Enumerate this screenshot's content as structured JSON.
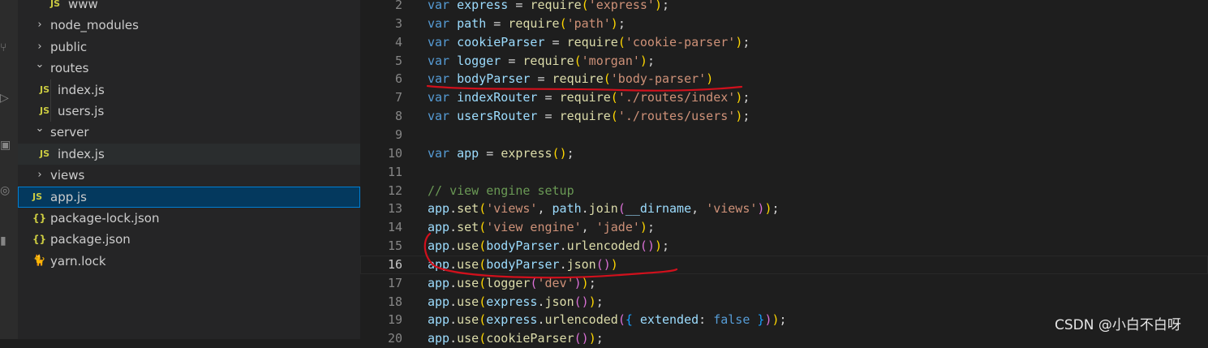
{
  "explorer": {
    "items": [
      {
        "name": "www",
        "icon": "js-file-icon",
        "icon_text": "JS"
      },
      {
        "name": "node_modules",
        "icon": "chevron-right-icon",
        "expanded": false
      },
      {
        "name": "public",
        "icon": "chevron-right-icon",
        "expanded": false
      },
      {
        "name": "routes",
        "icon": "chevron-down-icon",
        "expanded": true
      },
      {
        "name": "index.js",
        "icon": "js-file-icon",
        "icon_text": "JS"
      },
      {
        "name": "users.js",
        "icon": "js-file-icon",
        "icon_text": "JS"
      },
      {
        "name": "server",
        "icon": "chevron-down-icon",
        "expanded": true
      },
      {
        "name": "index.js",
        "icon": "js-file-icon",
        "icon_text": "JS"
      },
      {
        "name": "views",
        "icon": "chevron-right-icon",
        "expanded": false
      },
      {
        "name": "app.js",
        "icon": "js-file-icon",
        "icon_text": "JS",
        "selected": true
      },
      {
        "name": "package-lock.json",
        "icon": "json-file-icon",
        "icon_text": "{}"
      },
      {
        "name": "package.json",
        "icon": "json-file-icon",
        "icon_text": "{}"
      },
      {
        "name": "yarn.lock",
        "icon": "yarn-icon",
        "icon_text": "🐈"
      }
    ]
  },
  "editor": {
    "active_line": 16,
    "lines": [
      {
        "n": "2",
        "tokens": [
          [
            "kw",
            "var"
          ],
          [
            "p",
            " "
          ],
          [
            "vr",
            "express"
          ],
          [
            "p",
            " = "
          ],
          [
            "fn",
            "require"
          ],
          [
            "b1",
            "("
          ],
          [
            "st",
            "'express'"
          ],
          [
            "b1",
            ")"
          ],
          [
            "p",
            ";"
          ]
        ]
      },
      {
        "n": "3",
        "tokens": [
          [
            "kw",
            "var"
          ],
          [
            "p",
            " "
          ],
          [
            "vr",
            "path"
          ],
          [
            "p",
            " = "
          ],
          [
            "fn",
            "require"
          ],
          [
            "b1",
            "("
          ],
          [
            "st",
            "'path'"
          ],
          [
            "b1",
            ")"
          ],
          [
            "p",
            ";"
          ]
        ]
      },
      {
        "n": "4",
        "tokens": [
          [
            "kw",
            "var"
          ],
          [
            "p",
            " "
          ],
          [
            "vr",
            "cookieParser"
          ],
          [
            "p",
            " = "
          ],
          [
            "fn",
            "require"
          ],
          [
            "b1",
            "("
          ],
          [
            "st",
            "'cookie-parser'"
          ],
          [
            "b1",
            ")"
          ],
          [
            "p",
            ";"
          ]
        ]
      },
      {
        "n": "5",
        "tokens": [
          [
            "kw",
            "var"
          ],
          [
            "p",
            " "
          ],
          [
            "vr",
            "logger"
          ],
          [
            "p",
            " = "
          ],
          [
            "fn",
            "require"
          ],
          [
            "b1",
            "("
          ],
          [
            "st",
            "'morgan'"
          ],
          [
            "b1",
            ")"
          ],
          [
            "p",
            ";"
          ]
        ]
      },
      {
        "n": "6",
        "tokens": [
          [
            "kw",
            "var"
          ],
          [
            "p",
            " "
          ],
          [
            "vr",
            "bodyParser"
          ],
          [
            "p",
            " = "
          ],
          [
            "fn",
            "require"
          ],
          [
            "b1",
            "("
          ],
          [
            "st",
            "'body-parser'"
          ],
          [
            "b1",
            ")"
          ]
        ]
      },
      {
        "n": "7",
        "tokens": [
          [
            "kw",
            "var"
          ],
          [
            "p",
            " "
          ],
          [
            "vr",
            "indexRouter"
          ],
          [
            "p",
            " = "
          ],
          [
            "fn",
            "require"
          ],
          [
            "b1",
            "("
          ],
          [
            "st",
            "'./routes/index'"
          ],
          [
            "b1",
            ")"
          ],
          [
            "p",
            ";"
          ]
        ]
      },
      {
        "n": "8",
        "tokens": [
          [
            "kw",
            "var"
          ],
          [
            "p",
            " "
          ],
          [
            "vr",
            "usersRouter"
          ],
          [
            "p",
            " = "
          ],
          [
            "fn",
            "require"
          ],
          [
            "b1",
            "("
          ],
          [
            "st",
            "'./routes/users'"
          ],
          [
            "b1",
            ")"
          ],
          [
            "p",
            ";"
          ]
        ]
      },
      {
        "n": "9",
        "tokens": []
      },
      {
        "n": "10",
        "tokens": [
          [
            "kw",
            "var"
          ],
          [
            "p",
            " "
          ],
          [
            "vr",
            "app"
          ],
          [
            "p",
            " = "
          ],
          [
            "fn",
            "express"
          ],
          [
            "b1",
            "("
          ],
          [
            "b1",
            ")"
          ],
          [
            "p",
            ";"
          ]
        ]
      },
      {
        "n": "11",
        "tokens": []
      },
      {
        "n": "12",
        "tokens": [
          [
            "cm",
            "// view engine setup"
          ]
        ]
      },
      {
        "n": "13",
        "tokens": [
          [
            "vr",
            "app"
          ],
          [
            "p",
            "."
          ],
          [
            "fn",
            "set"
          ],
          [
            "b1",
            "("
          ],
          [
            "st",
            "'views'"
          ],
          [
            "p",
            ", "
          ],
          [
            "vr",
            "path"
          ],
          [
            "p",
            "."
          ],
          [
            "fn",
            "join"
          ],
          [
            "b2",
            "("
          ],
          [
            "vr",
            "__dirname"
          ],
          [
            "p",
            ", "
          ],
          [
            "st",
            "'views'"
          ],
          [
            "b2",
            ")"
          ],
          [
            "b1",
            ")"
          ],
          [
            "p",
            ";"
          ]
        ]
      },
      {
        "n": "14",
        "tokens": [
          [
            "vr",
            "app"
          ],
          [
            "p",
            "."
          ],
          [
            "fn",
            "set"
          ],
          [
            "b1",
            "("
          ],
          [
            "st",
            "'view engine'"
          ],
          [
            "p",
            ", "
          ],
          [
            "st",
            "'jade'"
          ],
          [
            "b1",
            ")"
          ],
          [
            "p",
            ";"
          ]
        ]
      },
      {
        "n": "15",
        "tokens": [
          [
            "vr",
            "app"
          ],
          [
            "p",
            "."
          ],
          [
            "fn",
            "use"
          ],
          [
            "b1",
            "("
          ],
          [
            "vr",
            "bodyParser"
          ],
          [
            "p",
            "."
          ],
          [
            "fn",
            "urlencoded"
          ],
          [
            "b2",
            "("
          ],
          [
            "b2",
            ")"
          ],
          [
            "b1",
            ")"
          ],
          [
            "p",
            ";"
          ]
        ]
      },
      {
        "n": "16",
        "tokens": [
          [
            "vr",
            "app"
          ],
          [
            "p",
            "."
          ],
          [
            "fn",
            "use"
          ],
          [
            "b1",
            "("
          ],
          [
            "vr",
            "bodyParser"
          ],
          [
            "p",
            "."
          ],
          [
            "fn",
            "json"
          ],
          [
            "b2",
            "("
          ],
          [
            "b2",
            ")"
          ],
          [
            "b1",
            ")"
          ]
        ]
      },
      {
        "n": "17",
        "tokens": [
          [
            "vr",
            "app"
          ],
          [
            "p",
            "."
          ],
          [
            "fn",
            "use"
          ],
          [
            "b1",
            "("
          ],
          [
            "fn",
            "logger"
          ],
          [
            "b2",
            "("
          ],
          [
            "st",
            "'dev'"
          ],
          [
            "b2",
            ")"
          ],
          [
            "b1",
            ")"
          ],
          [
            "p",
            ";"
          ]
        ]
      },
      {
        "n": "18",
        "tokens": [
          [
            "vr",
            "app"
          ],
          [
            "p",
            "."
          ],
          [
            "fn",
            "use"
          ],
          [
            "b1",
            "("
          ],
          [
            "vr",
            "express"
          ],
          [
            "p",
            "."
          ],
          [
            "fn",
            "json"
          ],
          [
            "b2",
            "("
          ],
          [
            "b2",
            ")"
          ],
          [
            "b1",
            ")"
          ],
          [
            "p",
            ";"
          ]
        ]
      },
      {
        "n": "19",
        "tokens": [
          [
            "vr",
            "app"
          ],
          [
            "p",
            "."
          ],
          [
            "fn",
            "use"
          ],
          [
            "b1",
            "("
          ],
          [
            "vr",
            "express"
          ],
          [
            "p",
            "."
          ],
          [
            "fn",
            "urlencoded"
          ],
          [
            "b2",
            "("
          ],
          [
            "b3",
            "{"
          ],
          [
            "p",
            " "
          ],
          [
            "vr",
            "extended"
          ],
          [
            "p",
            ": "
          ],
          [
            "kw",
            "false"
          ],
          [
            "p",
            " "
          ],
          [
            "b3",
            "}"
          ],
          [
            "b2",
            ")"
          ],
          [
            "b1",
            ")"
          ],
          [
            "p",
            ";"
          ]
        ]
      },
      {
        "n": "20",
        "tokens": [
          [
            "vr",
            "app"
          ],
          [
            "p",
            "."
          ],
          [
            "fn",
            "use"
          ],
          [
            "b1",
            "("
          ],
          [
            "fn",
            "cookieParser"
          ],
          [
            "b2",
            "("
          ],
          [
            "b2",
            ")"
          ],
          [
            "b1",
            ")"
          ],
          [
            "p",
            ";"
          ]
        ]
      }
    ]
  },
  "watermark": "CSDN @小白不白呀",
  "colors": {
    "annotation_ink": "#d1101c",
    "selection_bg": "#04395e",
    "selection_border": "#007fd4"
  }
}
